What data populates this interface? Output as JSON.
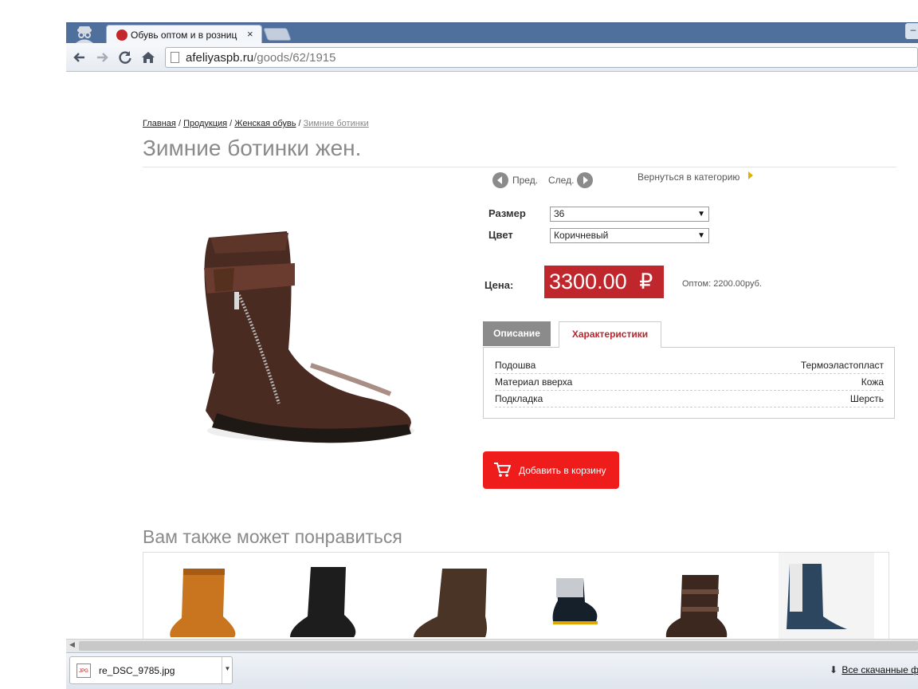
{
  "browser": {
    "tab_title": "Обувь оптом и в розниц",
    "tab_close": "×",
    "url_domain": "afeliyaspb.ru",
    "url_path": "/goods/62/1915",
    "window_btn": "–"
  },
  "breadcrumb": {
    "items": [
      "Главная",
      "Продукция",
      "Женская обувь"
    ],
    "separator": "/",
    "current": "Зимние ботинки"
  },
  "product": {
    "title": "Зимние ботинки жен.",
    "prev_label": "Пред.",
    "next_label": "След.",
    "back_to_category": "Вернуться в категорию",
    "size_label": "Размер",
    "size_value": "36",
    "color_label": "Цвет",
    "color_value": "Коричневый",
    "price_label": "Цена:",
    "price": "3300.00",
    "currency": "₽",
    "wholesale": "Оптом: 2200.00руб.",
    "tabs": {
      "description": "Описание",
      "specs": "Характеристики"
    },
    "specs": [
      {
        "key": "Подошва",
        "value": "Термоэластопласт"
      },
      {
        "key": "Материал вверха",
        "value": "Кожа"
      },
      {
        "key": "Подкладка",
        "value": "Шерсть"
      }
    ],
    "add_to_cart": "Добавить в корзину",
    "accent_color": "#c0272d",
    "cart_color": "#ef1c1c"
  },
  "related": {
    "title": "Вам также может понравиться"
  },
  "downloads": {
    "file_name": "re_DSC_9785.jpg",
    "file_type": "JPG",
    "all_downloads": "Все скачанные ф"
  }
}
